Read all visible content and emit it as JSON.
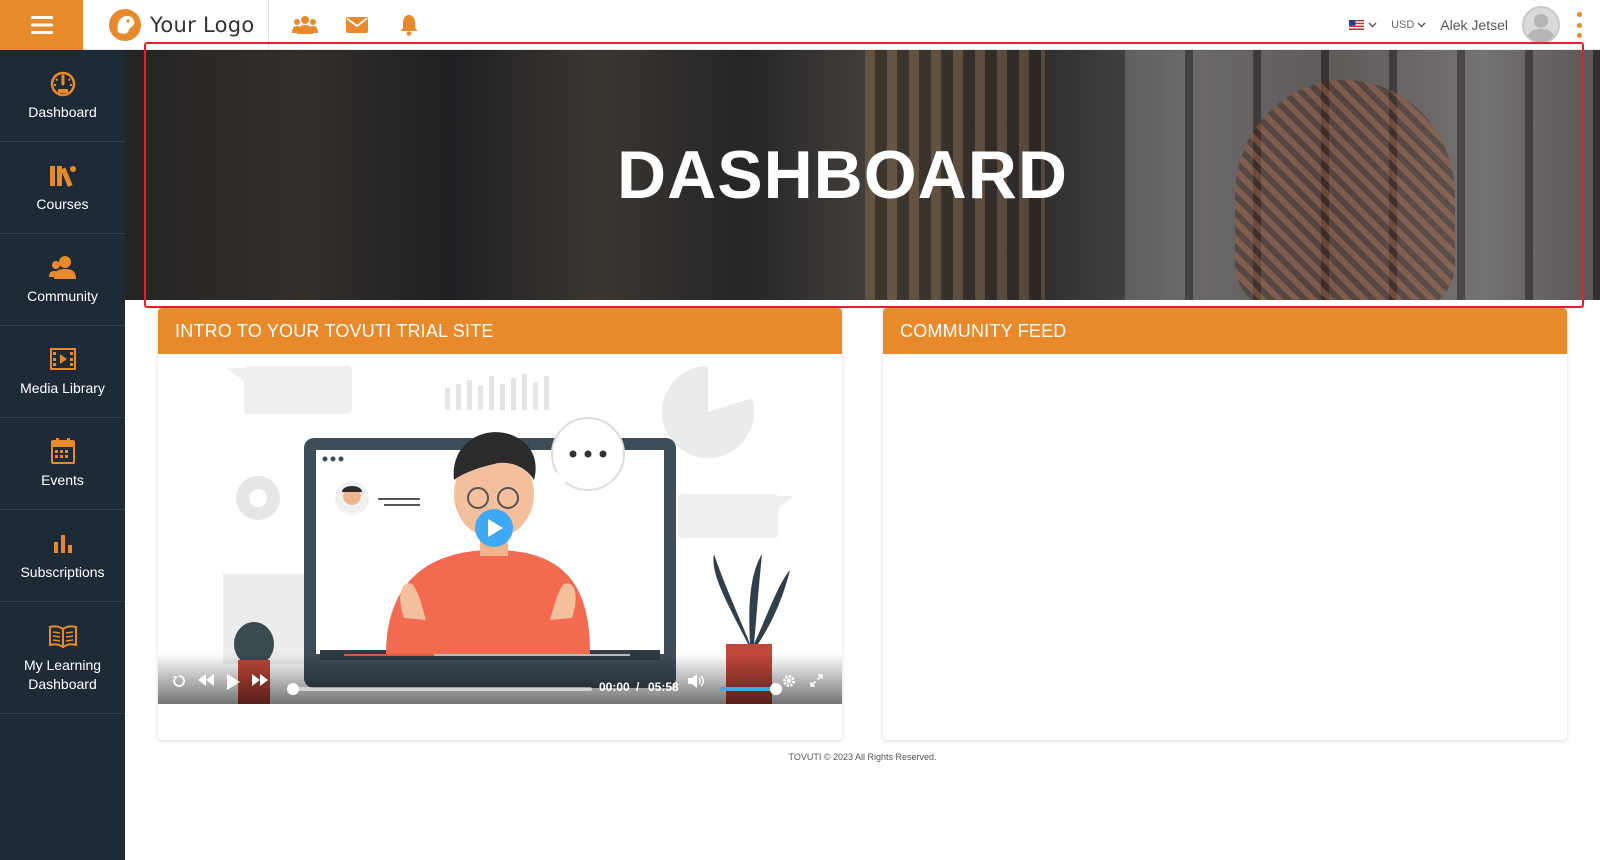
{
  "header": {
    "logo_text": "Your Logo",
    "currency": "USD",
    "user_name": "Alek Jetsel"
  },
  "sidebar": {
    "items": [
      {
        "label": "Dashboard",
        "icon": "gauge-icon"
      },
      {
        "label": "Courses",
        "icon": "books-icon"
      },
      {
        "label": "Community",
        "icon": "users-icon"
      },
      {
        "label": "Media Library",
        "icon": "film-icon"
      },
      {
        "label": "Events",
        "icon": "calendar-icon"
      },
      {
        "label": "Subscriptions",
        "icon": "bar-chart-icon"
      },
      {
        "label": "My Learning Dashboard",
        "icon": "open-book-icon"
      }
    ]
  },
  "hero": {
    "title": "DASHBOARD"
  },
  "intro_card": {
    "title": "INTRO TO YOUR TOVUTI TRIAL SITE",
    "video": {
      "current_time": "00:00",
      "separator": "/",
      "duration": "05:58",
      "progress": 0,
      "volume": 1
    }
  },
  "community_card": {
    "title": "COMMUNITY FEED"
  },
  "footer": {
    "text": "TOVUTI © 2023 All Rights Reserved."
  },
  "colors": {
    "accent": "#e8892b",
    "sidebar_bg": "#1f2a37",
    "highlight": "#e3212b",
    "play_button": "#3fa9f5"
  }
}
